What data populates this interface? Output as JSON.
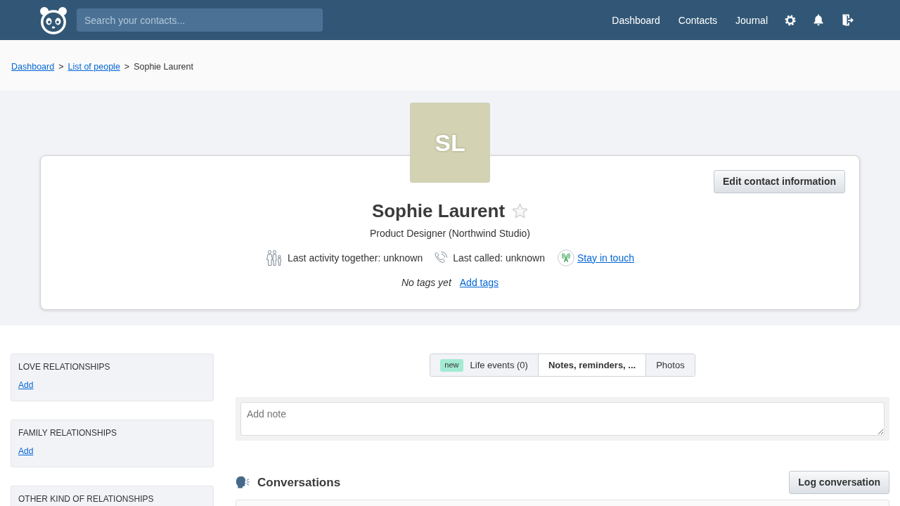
{
  "header": {
    "search": {
      "placeholder": "Search your contacts..."
    },
    "nav": [
      {
        "label": "Dashboard"
      },
      {
        "label": "Contacts"
      },
      {
        "label": "Journal"
      }
    ]
  },
  "breadcrumb": [
    {
      "label": "Dashboard",
      "link": true
    },
    {
      "separator": ">",
      "label": "List of people",
      "link": true
    },
    {
      "separator": ">",
      "label": "Sophie Laurent",
      "link": false
    }
  ],
  "profile": {
    "initials": "SL",
    "name": "Sophie Laurent",
    "favorite": false,
    "edit_button": "Edit contact information",
    "subtitle": "Product Designer (Northwind Studio)",
    "facts": [
      {
        "kind": "activity",
        "text": "Last activity together: unknown"
      },
      {
        "kind": "call",
        "text": "Last called: unknown"
      },
      {
        "kind": "stay_in_touch",
        "text": "Stay in touch"
      }
    ],
    "tags": {
      "empty_text": "No tags yet",
      "add_link": "Add tags"
    }
  },
  "sidebar": {
    "sections": [
      {
        "title": "LOVE RELATIONSHIPS",
        "action": "Add"
      },
      {
        "title": "FAMILY RELATIONSHIPS",
        "action": "Add"
      },
      {
        "title": "OTHER KIND OF RELATIONSHIPS"
      }
    ]
  },
  "tabs": [
    {
      "badge": "new",
      "label": "Life events (0)",
      "selected": false
    },
    {
      "label": "Notes, reminders, ...",
      "selected": true
    },
    {
      "label": "Photos",
      "selected": false
    }
  ],
  "note": {
    "placeholder": "Add note"
  },
  "conversations": {
    "title": "Conversations",
    "button": "Log conversation"
  }
}
